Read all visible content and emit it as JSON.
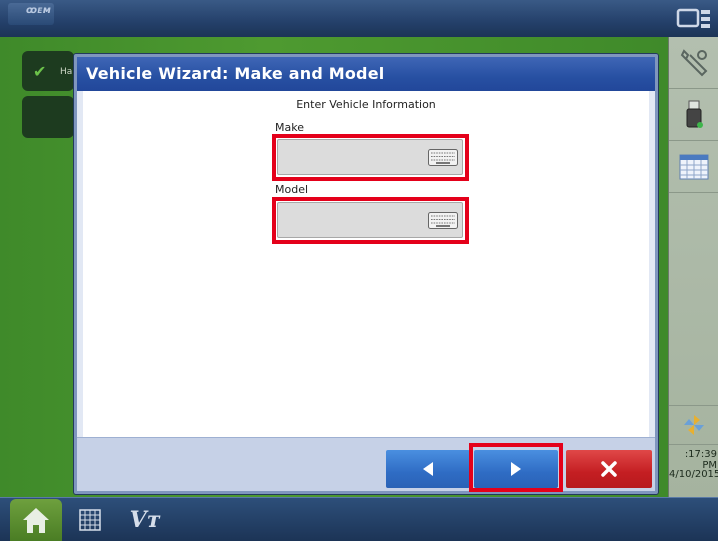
{
  "app": {
    "logo_text": "ꝏᴇᴍ",
    "status_label": "Ha",
    "clock_time": ":17:39 PM",
    "clock_date": "4/10/2015",
    "bottom_tab_vt": "Vᴛ"
  },
  "wizard": {
    "title": "Vehicle Wizard:  Make and Model",
    "section_heading": "Enter Vehicle Information",
    "make": {
      "label": "Make",
      "value": ""
    },
    "model": {
      "label": "Model",
      "value": ""
    },
    "footer": {
      "back_icon": "left-triangle-icon",
      "next_icon": "right-triangle-icon",
      "cancel_icon": "close-x-icon"
    }
  },
  "icons": {
    "status": "checkmark-icon",
    "keyboard": "keyboard-icon",
    "settings": "wrench-icon",
    "usb": "usb-drive-icon",
    "calendar": "calendar-icon",
    "pinwheel": "pinwheel-icon",
    "home": "home-icon",
    "grid": "grid-icon",
    "screens": "screens-icon"
  },
  "colors": {
    "title_bar": "#2750a2",
    "nav_button_blue": "#2f6cc4",
    "cancel_red": "#c41e22",
    "highlight_red": "#e4001a",
    "background_green": "#4e9a30"
  }
}
